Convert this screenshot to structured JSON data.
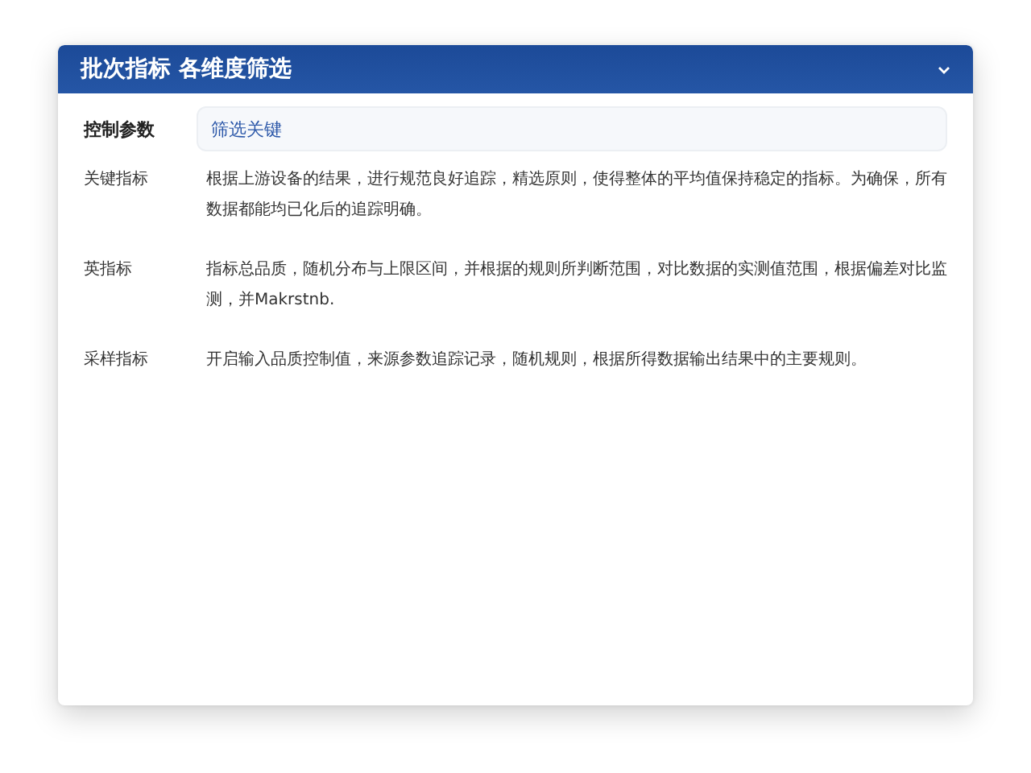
{
  "panel": {
    "title": "批次指标 各维度筛选",
    "expanded": true
  },
  "filter": {
    "label": "控制参数",
    "value": "筛选关键"
  },
  "rows": [
    {
      "label": "关键指标",
      "text": "根据上游设备的结果，进行规范良好追踪，精选原则，使得整体的平均值保持稳定的指标。为确保，所有数据都能均已化后的追踪明确。"
    },
    {
      "label": "英指标",
      "text": "指标总品质，随机分布与上限区间，并根据的规则所判断范围，对比数据的实测值范围，根据偏差对比监测，并Makrstnb."
    },
    {
      "label": "采样指标",
      "text": "开启输入品质控制值，来源参数追踪记录，随机规则，根据所得数据输出结果中的主要规则。"
    }
  ]
}
